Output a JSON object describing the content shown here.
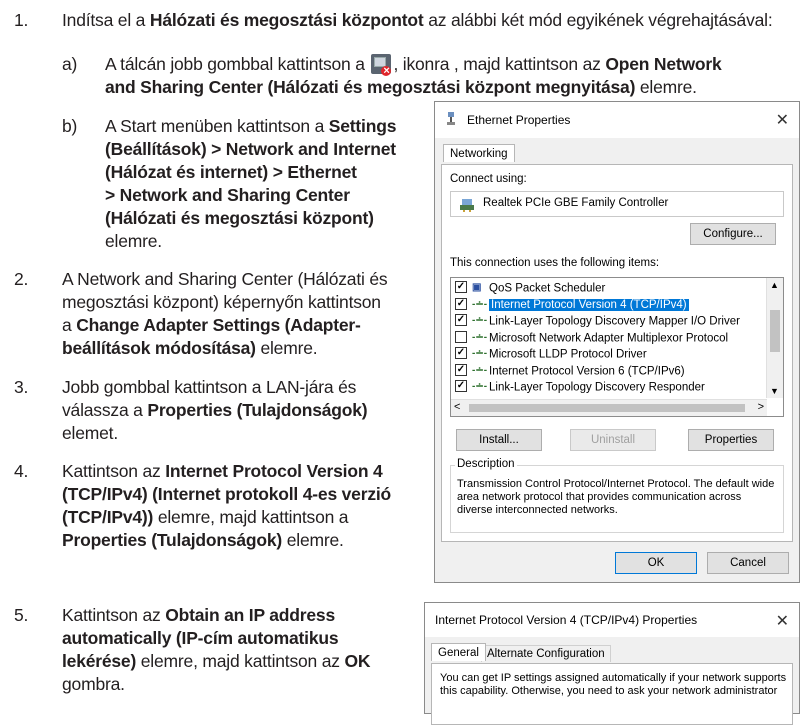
{
  "steps": {
    "s1": {
      "num": "1.",
      "pre": "Indítsa el a ",
      "bold": "Hálózati és megosztási központot",
      "post": " az alábbi két mód egyikének végrehajtásával:"
    },
    "a": {
      "letter": "a)",
      "line1_pre": "A tálcán jobb gombbal kattintson a ",
      "line1_mid": ", ikonra , majd kattintson az ",
      "line1_bold": "Open Network",
      "line2_bold": "and Sharing Center (Hálózati és megosztási központ megnyitása)",
      "line2_post": " elemre."
    },
    "b": {
      "letter": "b)",
      "l1_pre": "A Start menüben kattintson a ",
      "l1_bold": "Settings",
      "l2": "(Beállítások) > Network and Internet",
      "l3": "(Hálózat és internet) > Ethernet",
      "l4": "> Network and Sharing Center",
      "l5": "(Hálózati és megosztási központ)",
      "l6": "elemre."
    },
    "s2": {
      "num": "2.",
      "l1": "A Network and Sharing Center (Hálózati és",
      "l2": "megosztási központ) képernyőn kattintson",
      "l3_pre": "a ",
      "l3_bold": "Change Adapter Settings (Adapter-",
      "l4_bold": "beállítások módosítása)",
      "l4_post": " elemre."
    },
    "s3": {
      "num": "3.",
      "l1": "Jobb gombbal kattintson a LAN-jára és",
      "l2_pre": "válassza a ",
      "l2_bold": "Properties (Tulajdonságok)",
      "l3": "elemet."
    },
    "s4": {
      "num": "4.",
      "l1_pre": "Kattintson az ",
      "l1_bold": "Internet Protocol Version 4",
      "l2": "(TCP/IPv4) (Internet protokoll 4-es verzió",
      "l3_bold": "(TCP/IPv4))",
      "l3_post": " elemre, majd kattintson a",
      "l4_bold": "Properties (Tulajdonságok)",
      "l4_post": " elemre."
    },
    "s5": {
      "num": "5.",
      "l1_pre": "Kattintson az ",
      "l1_bold": "Obtain an IP address",
      "l2": "automatically (IP-cím automatikus",
      "l3_bold": "lekérése)",
      "l3_mid": " elemre, majd kattintson az ",
      "l3_bold2": "OK",
      "l4": "gombra."
    }
  },
  "ethernet_dialog": {
    "title": "Ethernet Properties",
    "tab": "Networking",
    "connect_using": "Connect using:",
    "adapter": "Realtek PCIe GBE Family Controller",
    "configure": "Configure...",
    "items_label": "This connection uses the following items:",
    "items": [
      {
        "label": "QoS Packet Scheduler",
        "checked": true
      },
      {
        "label": "Internet Protocol Version 4 (TCP/IPv4)",
        "checked": true,
        "selected": true
      },
      {
        "label": "Link-Layer Topology Discovery Mapper I/O Driver",
        "checked": true
      },
      {
        "label": "Microsoft Network Adapter Multiplexor Protocol",
        "checked": false
      },
      {
        "label": "Microsoft LLDP Protocol Driver",
        "checked": true
      },
      {
        "label": "Internet Protocol Version 6 (TCP/IPv6)",
        "checked": true
      },
      {
        "label": "Link-Layer Topology Discovery Responder",
        "checked": true
      }
    ],
    "install": "Install...",
    "uninstall": "Uninstall",
    "properties": "Properties",
    "description_label": "Description",
    "description": "Transmission Control Protocol/Internet Protocol. The default wide area network protocol that provides communication across diverse interconnected networks.",
    "ok": "OK",
    "cancel": "Cancel"
  },
  "ipv4_dialog": {
    "title": "Internet Protocol Version 4 (TCP/IPv4) Properties",
    "tab_general": "General",
    "tab_alternate": "Alternate Configuration",
    "text_l1": "You can get IP settings assigned automatically if your network supports",
    "text_l2": "this capability. Otherwise, you need to ask your network administrator"
  }
}
